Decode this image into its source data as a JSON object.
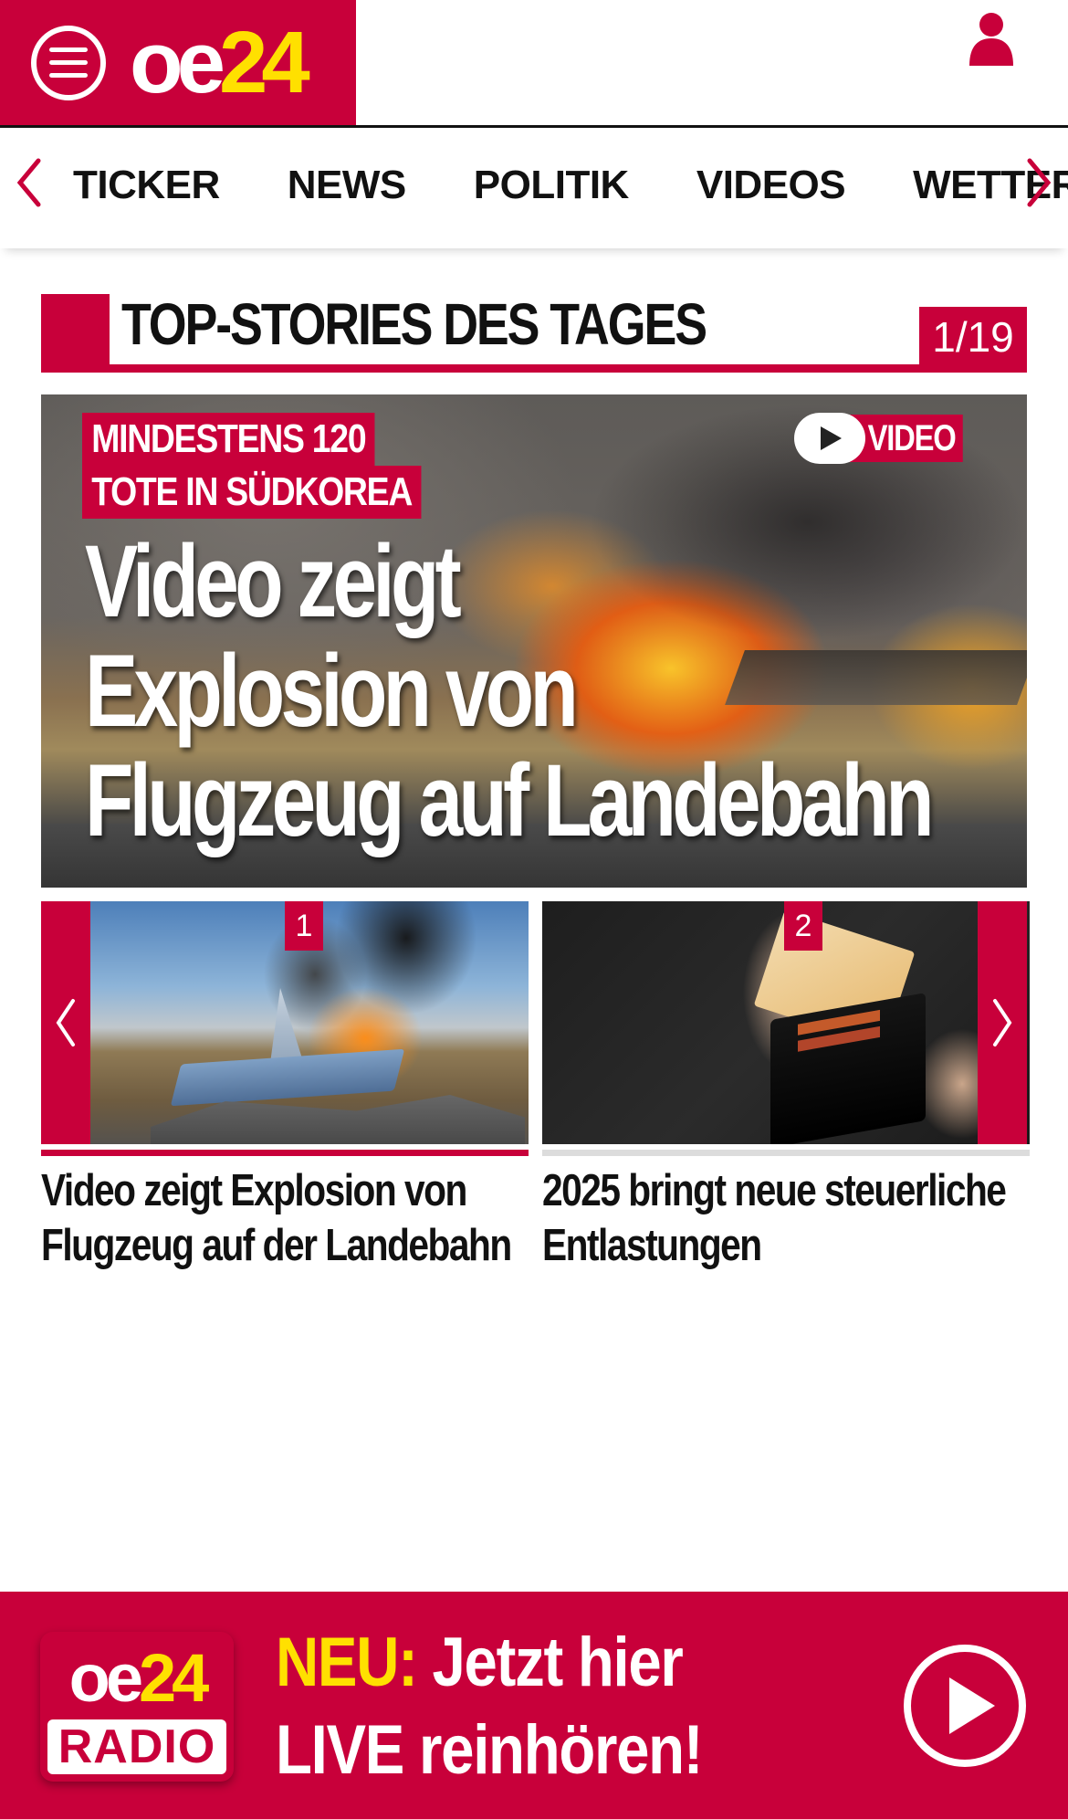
{
  "header": {
    "logo_oe": "oe",
    "logo_num": "24",
    "menu_icon": "hamburger-menu-icon",
    "user_icon": "user-icon"
  },
  "nav": {
    "items": [
      "TICKER",
      "NEWS",
      "POLITIK",
      "VIDEOS",
      "WETTER"
    ],
    "left_icon": "chevron-left-icon",
    "right_icon": "chevron-right-icon"
  },
  "section": {
    "title": "TOP-STORIES DES TAGES",
    "counter": "1/19"
  },
  "hero": {
    "kicker_line1": "MINDESTENS 120",
    "kicker_line2": "TOTE IN SÜDKOREA",
    "title_line1": "Video zeigt",
    "title_line2": "Explosion von",
    "title_line3": "Flugzeug auf Landebahn",
    "video_label": "VIDEO"
  },
  "slider": {
    "cards": [
      {
        "number": "1",
        "title": "Video zeigt Explosion von Flugzeug auf der Landebahn",
        "active": true
      },
      {
        "number": "2",
        "title": "2025 bringt neue steuerliche Entlastungen",
        "active": false
      }
    ]
  },
  "radio": {
    "logo_oe": "oe",
    "logo_num": "24",
    "logo_label": "RADIO",
    "highlight": "NEU:",
    "line1_rest": "Jetzt hier",
    "line2": "LIVE reinhören!"
  },
  "colors": {
    "brand_red": "#c8003a",
    "logo_yellow": "#ffe000",
    "text_dark": "#111111"
  }
}
